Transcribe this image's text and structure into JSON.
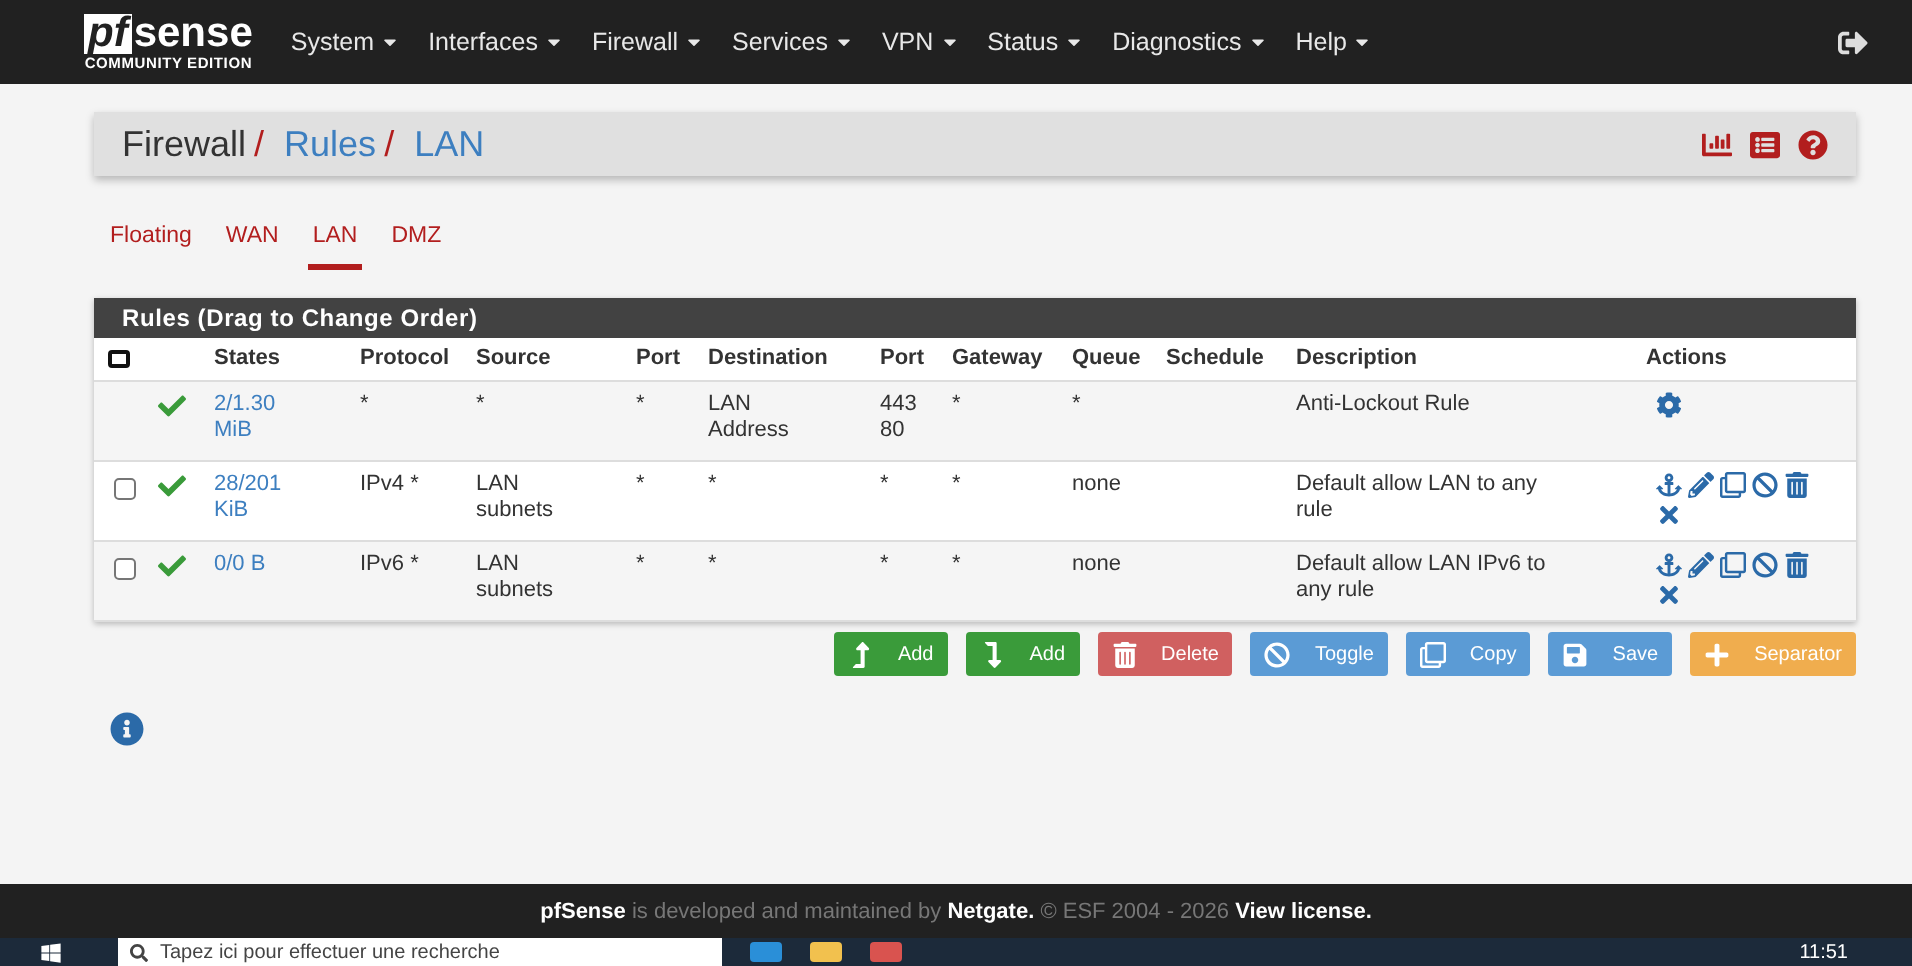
{
  "navbar": {
    "logo": "sense",
    "logo_mark": "pf",
    "edition": "COMMUNITY EDITION",
    "menus": [
      "System",
      "Interfaces",
      "Firewall",
      "Services",
      "VPN",
      "Status",
      "Diagnostics",
      "Help"
    ]
  },
  "breadcrumb": [
    "Firewall",
    "Rules",
    "LAN"
  ],
  "breadcrumb_separator": "/",
  "select_all_checked": false,
  "tabs": [
    {
      "label": "Floating",
      "selected": false
    },
    {
      "label": "WAN",
      "selected": false
    },
    {
      "label": "LAN",
      "selected": true
    },
    {
      "label": "DMZ",
      "selected": false
    }
  ],
  "panel_title": "Rules (Drag to Change Order)",
  "columns": [
    "States",
    "Protocol",
    "Source",
    "Port",
    "Destination",
    "Port",
    "Gateway",
    "Queue",
    "Schedule",
    "Description",
    "Actions"
  ],
  "rows": [
    {
      "kind": "anti-lockout",
      "enabled": true,
      "states": "2/1.30 MiB",
      "protocol": "*",
      "source": "*",
      "source_port": "*",
      "destination": "LAN Address",
      "destination_port": "443 80",
      "gateway": "*",
      "queue": "*",
      "description": "Anti-Lockout Rule"
    },
    {
      "kind": "rule",
      "checked": false,
      "enabled": true,
      "states": "28/201 KiB",
      "protocol": "IPv4 *",
      "source": "LAN subnets",
      "source_port": "*",
      "destination": "*",
      "destination_port": "*",
      "gateway": "*",
      "queue": "none",
      "description": "Default allow LAN to any rule"
    },
    {
      "kind": "rule",
      "checked": false,
      "enabled": true,
      "states": "0/0 B",
      "protocol": "IPv6 *",
      "source": "LAN subnets",
      "source_port": "*",
      "destination": "*",
      "destination_port": "*",
      "gateway": "*",
      "queue": "none",
      "description": "Default allow LAN IPv6 to any rule"
    }
  ],
  "buttons": [
    {
      "kind": "add-top",
      "label": "Add"
    },
    {
      "kind": "add-bottom",
      "label": "Add"
    },
    {
      "kind": "delete",
      "label": "Delete"
    },
    {
      "kind": "toggle",
      "label": "Toggle"
    },
    {
      "kind": "copy",
      "label": "Copy"
    },
    {
      "kind": "save",
      "label": "Save"
    },
    {
      "kind": "separator",
      "label": "Separator"
    }
  ],
  "footer": {
    "brand": "pfSense",
    "text1": " is developed and maintained by ",
    "company": "Netgate.",
    "text2": " © ESF 2004 - 2026 ",
    "link": "View license."
  },
  "taskbar": {
    "search_placeholder": "Tapez ici pour effectuer une recherche",
    "time": "11:51"
  }
}
